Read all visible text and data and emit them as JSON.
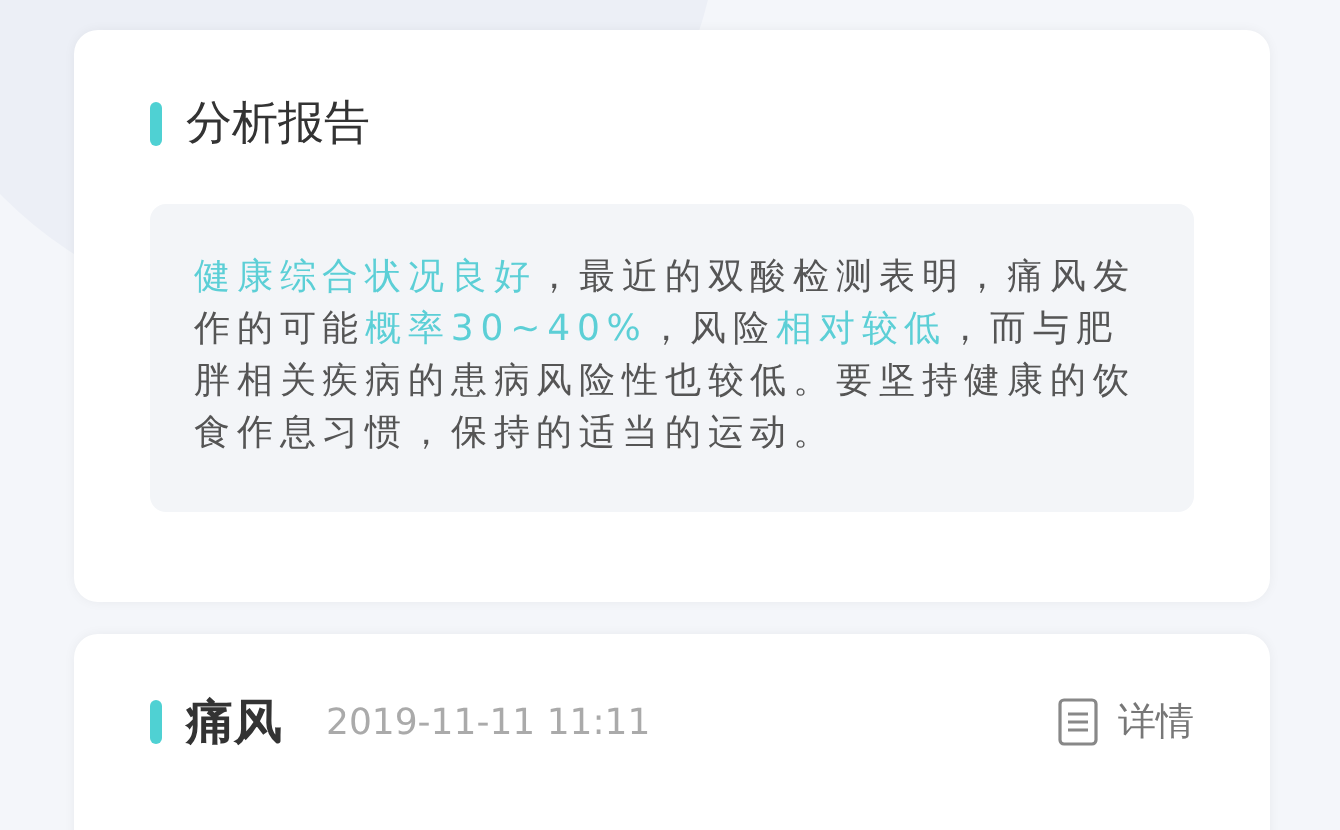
{
  "report": {
    "title": "分析报告",
    "segments": [
      {
        "text": "健康综合状况良好",
        "highlight": true
      },
      {
        "text": "，最近的双酸检测表明，痛风发作的可能",
        "highlight": false
      },
      {
        "text": "概率30~40%",
        "highlight": true
      },
      {
        "text": "，风险",
        "highlight": false
      },
      {
        "text": "相对较低",
        "highlight": true
      },
      {
        "text": "，而与肥胖相关疾病的患病风险性也较低。要坚持健康的饮食作息习惯，保持的适当的运动。",
        "highlight": false
      }
    ]
  },
  "record": {
    "title": "痛风",
    "time": "2019-11-11 11:11",
    "action": "详情"
  }
}
